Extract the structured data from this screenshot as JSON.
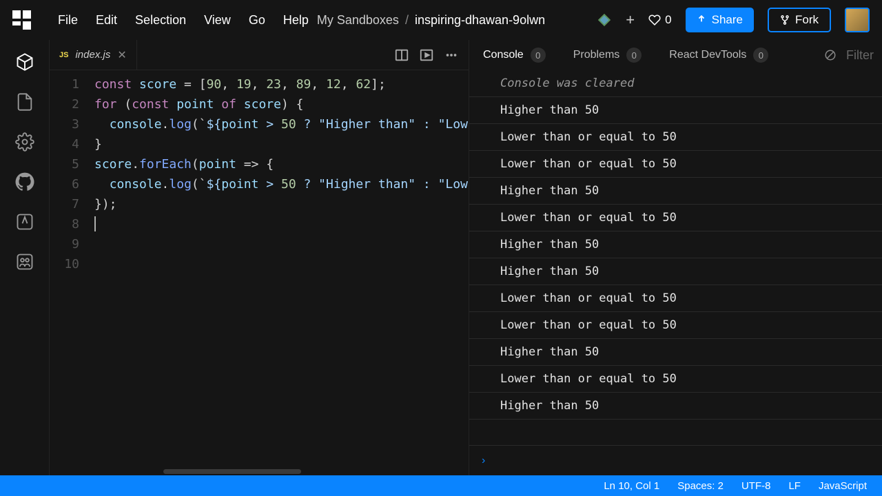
{
  "menu": [
    "File",
    "Edit",
    "Selection",
    "View",
    "Go",
    "Help"
  ],
  "breadcrumb": {
    "parent": "My Sandboxes",
    "name": "inspiring-dhawan-9olwn"
  },
  "likes": 0,
  "share_label": "Share",
  "fork_label": "Fork",
  "tab": {
    "icon": "JS",
    "filename": "index.js"
  },
  "code_lines": [
    [
      [
        "kw",
        "const"
      ],
      [
        "",
        " "
      ],
      [
        "var",
        "score"
      ],
      [
        "",
        " = ["
      ],
      [
        "num",
        "90"
      ],
      [
        "",
        ", "
      ],
      [
        "num",
        "19"
      ],
      [
        "",
        ", "
      ],
      [
        "num",
        "23"
      ],
      [
        "",
        ", "
      ],
      [
        "num",
        "89"
      ],
      [
        "",
        ", "
      ],
      [
        "num",
        "12"
      ],
      [
        "",
        ", "
      ],
      [
        "num",
        "62"
      ],
      [
        "",
        "];"
      ]
    ],
    [
      [
        "",
        ""
      ]
    ],
    [
      [
        "kw",
        "for"
      ],
      [
        "",
        " ("
      ],
      [
        "kw",
        "const"
      ],
      [
        "",
        " "
      ],
      [
        "var",
        "point"
      ],
      [
        "",
        " "
      ],
      [
        "kw",
        "of"
      ],
      [
        "",
        " "
      ],
      [
        "var",
        "score"
      ],
      [
        "",
        ") {"
      ]
    ],
    [
      [
        "",
        "  "
      ],
      [
        "var",
        "console"
      ],
      [
        "",
        "."
      ],
      [
        "fn",
        "log"
      ],
      [
        "",
        "(`"
      ],
      [
        "str",
        "${"
      ],
      [
        "var",
        "point"
      ],
      [
        "str",
        " > "
      ],
      [
        "num",
        "50"
      ],
      [
        "str",
        " ? \"Higher than\" : \"Low"
      ]
    ],
    [
      [
        "",
        "}"
      ]
    ],
    [
      [
        "",
        ""
      ]
    ],
    [
      [
        "var",
        "score"
      ],
      [
        "",
        "."
      ],
      [
        "fn",
        "forEach"
      ],
      [
        "",
        "("
      ],
      [
        "var",
        "point"
      ],
      [
        "",
        " => {"
      ]
    ],
    [
      [
        "",
        "  "
      ],
      [
        "var",
        "console"
      ],
      [
        "",
        "."
      ],
      [
        "fn",
        "log"
      ],
      [
        "",
        "(`"
      ],
      [
        "str",
        "${"
      ],
      [
        "var",
        "point"
      ],
      [
        "str",
        " > "
      ],
      [
        "num",
        "50"
      ],
      [
        "str",
        " ? \"Higher than\" : \"Low"
      ]
    ],
    [
      [
        "",
        "});"
      ]
    ],
    [
      [
        "",
        ""
      ]
    ]
  ],
  "dev_tabs": [
    {
      "label": "Console",
      "count": 0,
      "active": true
    },
    {
      "label": "Problems",
      "count": 0,
      "active": false
    },
    {
      "label": "React DevTools",
      "count": 0,
      "active": false
    }
  ],
  "filter_label": "Filter",
  "console": [
    {
      "type": "info",
      "text": "Console was cleared"
    },
    {
      "type": "log",
      "text": "Higher than 50"
    },
    {
      "type": "log",
      "text": "Lower than or equal to 50"
    },
    {
      "type": "log",
      "text": "Lower than or equal to 50"
    },
    {
      "type": "log",
      "text": "Higher than 50"
    },
    {
      "type": "log",
      "text": "Lower than or equal to 50"
    },
    {
      "type": "log",
      "text": "Higher than 50"
    },
    {
      "type": "log",
      "text": "Higher than 50"
    },
    {
      "type": "log",
      "text": "Lower than or equal to 50"
    },
    {
      "type": "log",
      "text": "Lower than or equal to 50"
    },
    {
      "type": "log",
      "text": "Higher than 50"
    },
    {
      "type": "log",
      "text": "Lower than or equal to 50"
    },
    {
      "type": "log",
      "text": "Higher than 50"
    }
  ],
  "status": {
    "position": "Ln 10, Col 1",
    "spaces": "Spaces: 2",
    "encoding": "UTF-8",
    "eol": "LF",
    "language": "JavaScript"
  }
}
